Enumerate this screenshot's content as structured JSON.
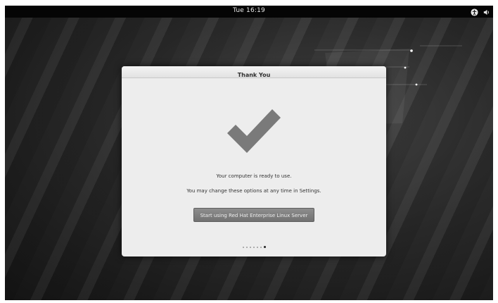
{
  "top_bar": {
    "clock": "Tue 16:19",
    "tray_icons": [
      "accessibility-icon",
      "volume-icon"
    ]
  },
  "dialog": {
    "title": "Thank You",
    "icon": "checkmark-icon",
    "message_ready": "Your computer is ready to use.",
    "message_settings": "You may change these options at any time in Settings.",
    "start_button_label": "Start using Red Hat Enterprise Linux Server",
    "pager": {
      "total": 7,
      "current": 7
    }
  },
  "colors": {
    "checkmark": "#7a7a7a",
    "dialog_bg": "#ededed",
    "top_bar_bg": "#050505"
  }
}
